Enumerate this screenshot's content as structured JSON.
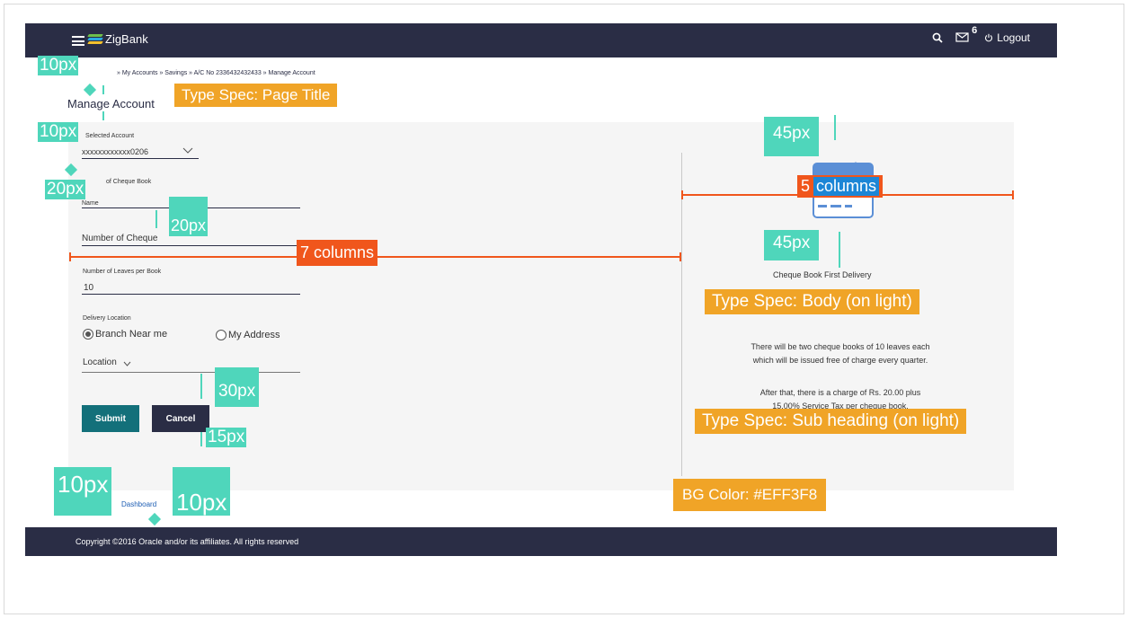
{
  "header": {
    "app_name": "ZigBank",
    "mail_badge": "6",
    "logout_label": "Logout"
  },
  "breadcrumb": "» My Accounts » Savings » A/C No 2336432432433  » Manage Account",
  "page_title": "Manage Account",
  "form": {
    "selected_account_label": "Selected Account",
    "selected_account_value": "xxxxxxxxxxxx0206",
    "cheque_book_label": "of Cheque  Book",
    "name_label": "Name",
    "number_of_cheque_label": "Number of Cheque",
    "leaves_label": "Number of Leaves  per Book",
    "leaves_value": "10",
    "delivery_label": "Delivery  Location",
    "radio_branch": "Branch Near me",
    "radio_address": "My Address",
    "location_label": "Location",
    "submit_label": "Submit",
    "cancel_label": "Cancel"
  },
  "dashboard_link": "Dashboard",
  "footer": "Copyright ©2016 Oracle and/or its affiliates. All rights reserved",
  "right_panel": {
    "heading": "Cheque Book First Delivery",
    "para1_line1": "There will be two cheque books of 10 leaves each",
    "para1_line2": "which will be issued free of charge every quarter.",
    "para2_line1": "After that, there is a charge of Rs. 20.00 plus",
    "para2_line2": "15.00% Service Tax per cheque book."
  },
  "annotations": {
    "page_title_spec": "Type Spec: Page Title",
    "body_spec": "Type Spec: Body (on light)",
    "subheading_spec": "Type Spec: Sub heading  (on light)",
    "bg_color": "BG Color: #EFF3F8",
    "seven_columns": "7 columns",
    "five_prefix": "5",
    "five_columns": "columns",
    "m_10px_a": "10px",
    "m_10px_b": "10px",
    "m_20px_a": "20px",
    "m_20px_b": "20px",
    "m_45px_a": "45px",
    "m_45px_b": "45px",
    "m_30px": "30px",
    "m_15px": "15px",
    "m_10px_c": "10px",
    "m_10px_d": "10px"
  },
  "colors": {
    "header_bg": "#2a2d45",
    "submit_bg": "#13707a",
    "annotation_orange": "#f0a427",
    "annotation_teal": "#4fd6bb",
    "annotation_red": "#f0561c",
    "stated_bg": "#EFF3F8"
  }
}
